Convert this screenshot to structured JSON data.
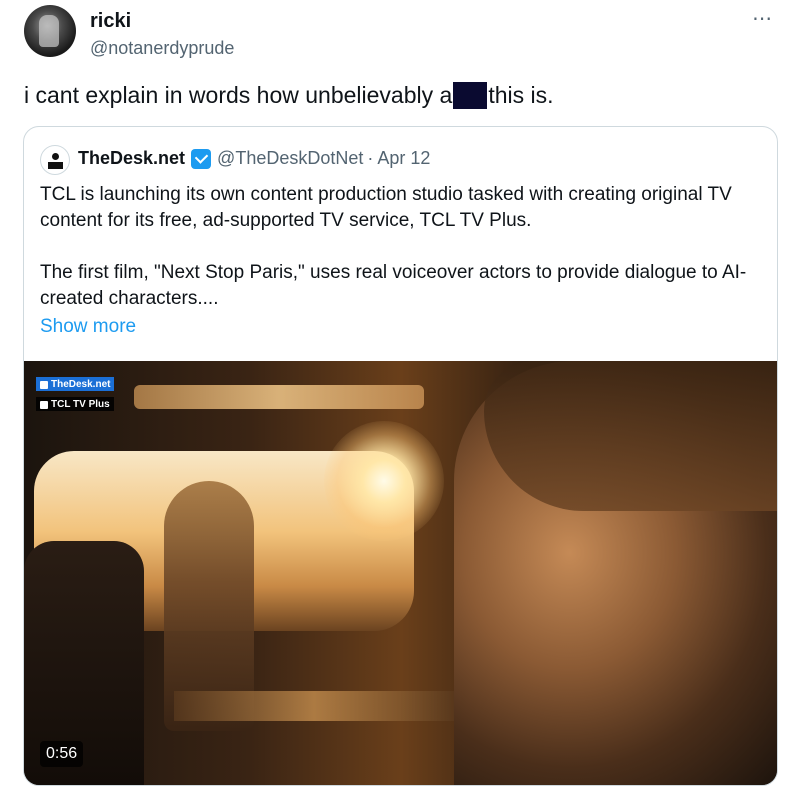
{
  "author": {
    "display_name": "ricki",
    "handle": "@notanerdyprude"
  },
  "more_icon": "⋯",
  "tweet": {
    "text_before": "i cant explain in words how unbelievably a",
    "text_after": "this is."
  },
  "quoted": {
    "name": "TheDesk.net",
    "handle": "@TheDeskDotNet",
    "separator": "·",
    "date": "Apr 12",
    "paragraphs": [
      "TCL is launching its own content production studio tasked with creating original TV content for its free, ad-supported TV service, TCL TV Plus.",
      "The first film, \"Next Stop Paris,\" uses real voiceover actors to provide dialogue to AI-created characters...."
    ],
    "show_more": "Show more",
    "media": {
      "badge_1": "TheDesk.net",
      "badge_2": "TCL TV Plus",
      "duration": "0:56"
    }
  },
  "colors": {
    "link": "#1d9bf0",
    "secondary": "#536471",
    "border": "#cfd9de",
    "redaction": "#0a0a30"
  }
}
